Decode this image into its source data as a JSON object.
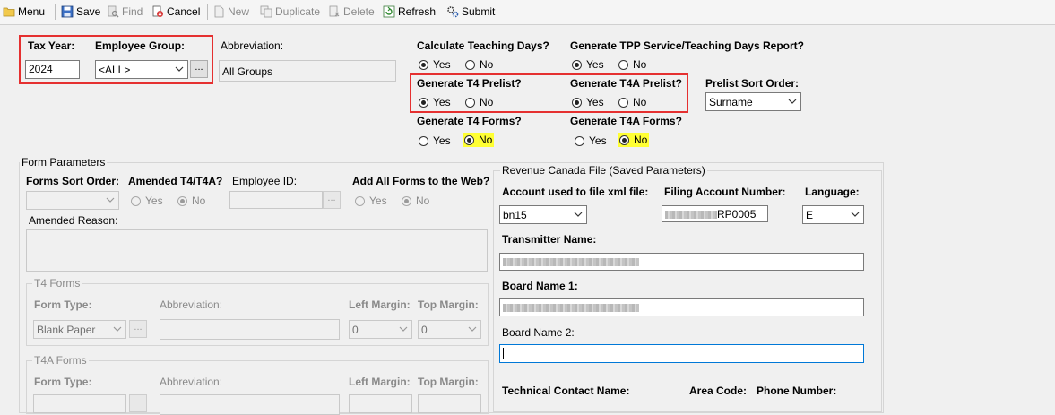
{
  "toolbar": {
    "menu": "Menu",
    "save": "Save",
    "find": "Find",
    "cancel": "Cancel",
    "new": "New",
    "duplicate": "Duplicate",
    "delete": "Delete",
    "refresh": "Refresh",
    "submit": "Submit"
  },
  "header": {
    "tax_year_label": "Tax Year:",
    "tax_year_value": "2024",
    "employee_group_label": "Employee Group:",
    "employee_group_value": "<ALL>",
    "abbreviation_label": "Abbreviation:",
    "abbreviation_value": "All Groups",
    "ellipsis": "..."
  },
  "options": {
    "yes": "Yes",
    "no": "No",
    "calc_teaching_days": {
      "label": "Calculate Teaching Days?",
      "selected": "Yes"
    },
    "gen_tpp_report": {
      "label": "Generate TPP Service/Teaching Days Report?",
      "selected": "Yes"
    },
    "gen_t4_prelist": {
      "label": "Generate T4 Prelist?",
      "selected": "Yes"
    },
    "gen_t4a_prelist": {
      "label": "Generate T4A Prelist?",
      "selected": "Yes"
    },
    "prelist_sort": {
      "label": "Prelist Sort Order:",
      "value": "Surname"
    },
    "gen_t4_forms": {
      "label": "Generate T4 Forms?",
      "selected": "No"
    },
    "gen_t4a_forms": {
      "label": "Generate T4A Forms?",
      "selected": "No"
    }
  },
  "form_params": {
    "title": "Form Parameters",
    "forms_sort_order_label": "Forms Sort Order:",
    "forms_sort_order_value": "",
    "amended_label": "Amended T4/T4A?",
    "amended_selected": "No",
    "employee_id_label": "Employee ID:",
    "employee_id_value": "",
    "add_all_web_label": "Add All Forms to the Web?",
    "add_all_web_selected": "No",
    "amended_reason_label": "Amended Reason:",
    "amended_reason_value": "",
    "t4_forms": {
      "title": "T4 Forms",
      "form_type_label": "Form Type:",
      "form_type_value": "Blank Paper",
      "abbreviation_label": "Abbreviation:",
      "left_margin_label": "Left Margin:",
      "left_margin_value": "0",
      "top_margin_label": "Top Margin:",
      "top_margin_value": "0"
    },
    "t4a_forms": {
      "title": "T4A Forms",
      "form_type_label": "Form Type:",
      "abbreviation_label": "Abbreviation:",
      "left_margin_label": "Left Margin:",
      "top_margin_label": "Top Margin:"
    }
  },
  "revenue": {
    "title": "Revenue Canada File (Saved Parameters)",
    "account_label": "Account used to file xml file:",
    "account_value": "bn15",
    "filing_label": "Filing Account Number:",
    "filing_value": "RP0005",
    "language_label": "Language:",
    "language_value": "E",
    "transmitter_label": "Transmitter Name:",
    "board1_label": "Board Name 1:",
    "board2_label": "Board Name 2:",
    "board2_value": "",
    "tech_contact_label": "Technical Contact Name:",
    "area_code_label": "Area Code:",
    "phone_label": "Phone Number:"
  }
}
